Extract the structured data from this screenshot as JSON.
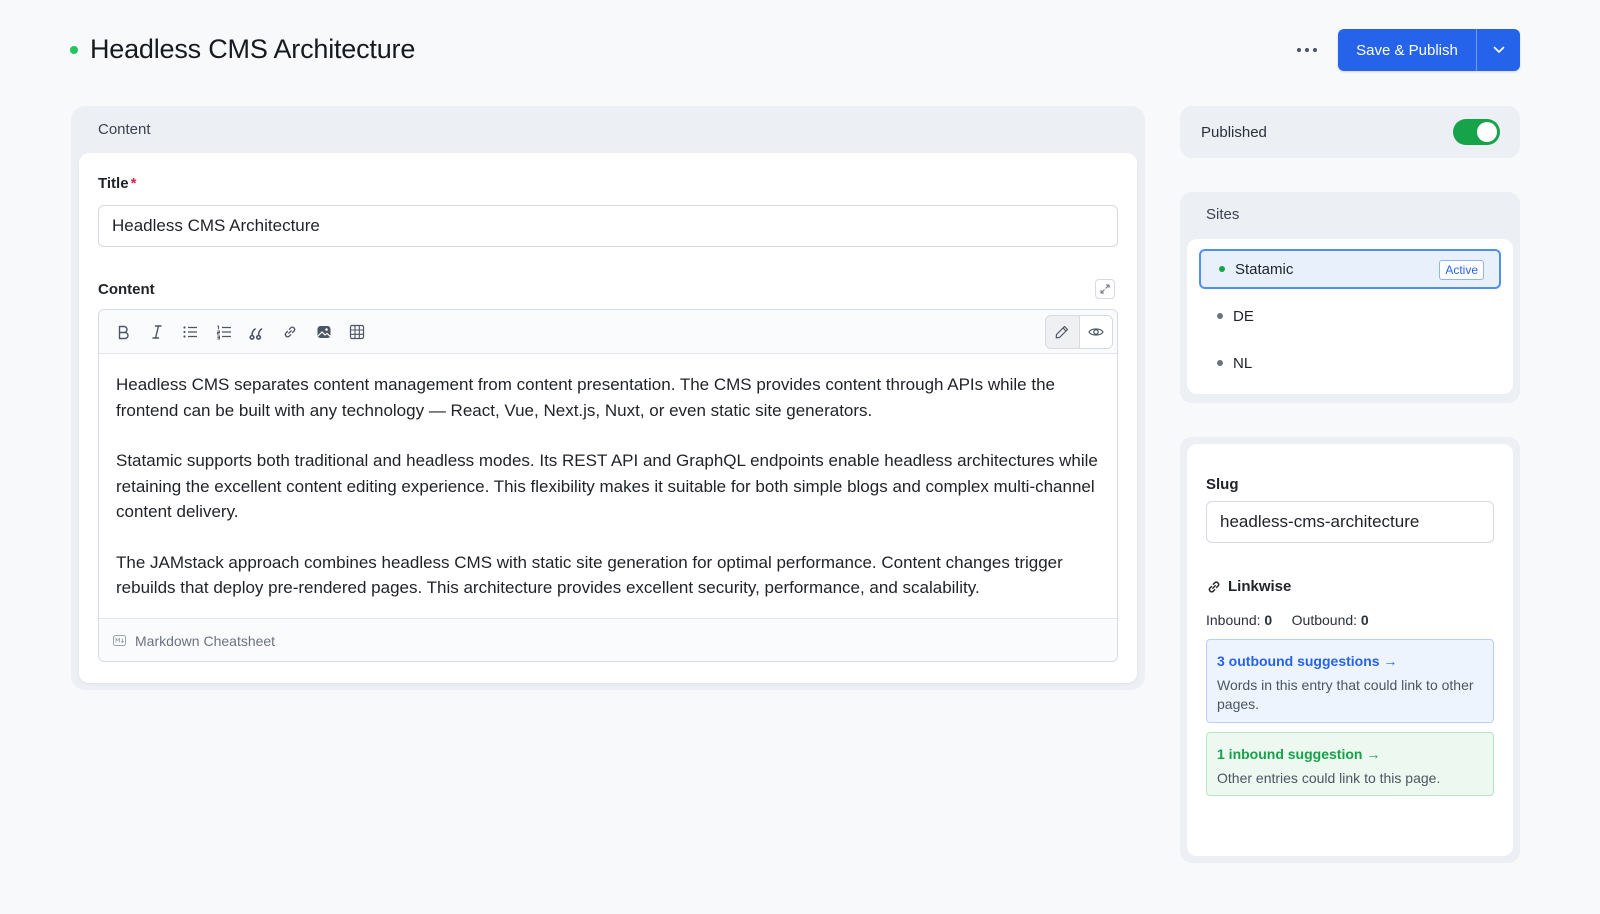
{
  "header": {
    "title": "Headless CMS Architecture",
    "publish_label": "Save & Publish"
  },
  "main": {
    "panel_label": "Content",
    "title_field": {
      "label": "Title",
      "required_mark": "*",
      "value": "Headless CMS Architecture"
    },
    "content_field": {
      "label": "Content",
      "paragraphs": [
        "Headless CMS separates content management from content presentation. The CMS provides content through APIs while the frontend can be built with any technology — React, Vue, Next.js, Nuxt, or even static site generators.",
        "Statamic supports both traditional and headless modes. Its REST API and GraphQL endpoints enable headless architectures while retaining the excellent content editing experience. This flexibility makes it suitable for both simple blogs and complex multi-channel content delivery.",
        "The JAMstack approach combines headless CMS with static site generation for optimal performance. Content changes trigger rebuilds that deploy pre-rendered pages. This architecture provides excellent security, performance, and scalability."
      ],
      "footer_link": "Markdown Cheatsheet"
    },
    "toolbar_icons": [
      "bold-icon",
      "italic-icon",
      "bulleted-list-icon",
      "numbered-list-icon",
      "quote-icon",
      "link-icon",
      "image-icon",
      "table-icon"
    ]
  },
  "sidebar": {
    "published_label": "Published",
    "published_on": true,
    "sites_label": "Sites",
    "sites": [
      {
        "name": "Statamic",
        "badge": "Active"
      },
      {
        "name": "DE"
      },
      {
        "name": "NL"
      }
    ],
    "slug_label": "Slug",
    "slug_value": "headless-cms-architecture",
    "linkwise": {
      "title": "Linkwise",
      "inbound_label": "Inbound:",
      "inbound_count": "0",
      "outbound_label": "Outbound:",
      "outbound_count": "0",
      "outbound_suggestion_title": "3 outbound suggestions →",
      "outbound_suggestion_desc": "Words in this entry that could link to other pages.",
      "inbound_suggestion_title": "1 inbound suggestion →",
      "inbound_suggestion_desc": "Other entries could link to this page."
    }
  },
  "colors": {
    "accent": "#2563eb",
    "success": "#16a34a",
    "status_dot": "#22c55e",
    "required": "#e11d48"
  }
}
